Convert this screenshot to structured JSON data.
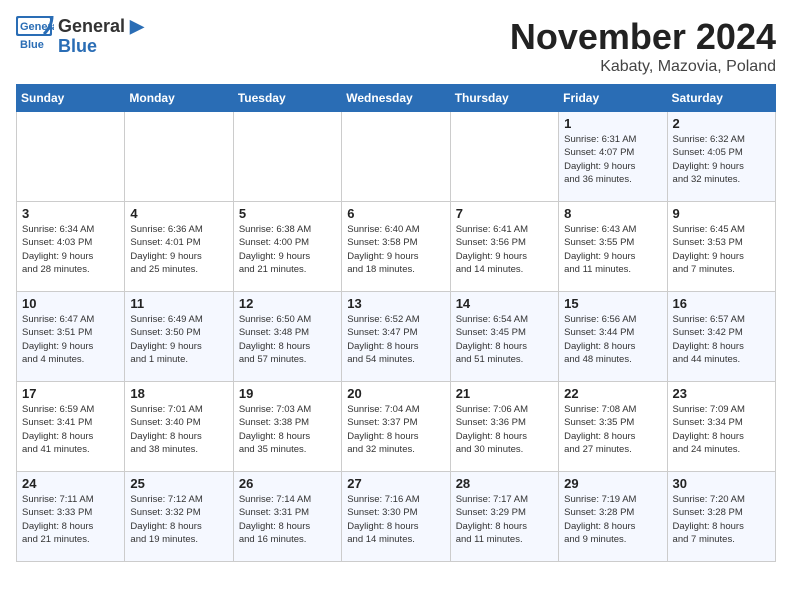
{
  "header": {
    "logo": {
      "line1": "General",
      "line2": "Blue"
    },
    "title": "November 2024",
    "location": "Kabaty, Mazovia, Poland"
  },
  "days_of_week": [
    "Sunday",
    "Monday",
    "Tuesday",
    "Wednesday",
    "Thursday",
    "Friday",
    "Saturday"
  ],
  "weeks": [
    [
      {
        "day": "",
        "info": ""
      },
      {
        "day": "",
        "info": ""
      },
      {
        "day": "",
        "info": ""
      },
      {
        "day": "",
        "info": ""
      },
      {
        "day": "",
        "info": ""
      },
      {
        "day": "1",
        "info": "Sunrise: 6:31 AM\nSunset: 4:07 PM\nDaylight: 9 hours\nand 36 minutes."
      },
      {
        "day": "2",
        "info": "Sunrise: 6:32 AM\nSunset: 4:05 PM\nDaylight: 9 hours\nand 32 minutes."
      }
    ],
    [
      {
        "day": "3",
        "info": "Sunrise: 6:34 AM\nSunset: 4:03 PM\nDaylight: 9 hours\nand 28 minutes."
      },
      {
        "day": "4",
        "info": "Sunrise: 6:36 AM\nSunset: 4:01 PM\nDaylight: 9 hours\nand 25 minutes."
      },
      {
        "day": "5",
        "info": "Sunrise: 6:38 AM\nSunset: 4:00 PM\nDaylight: 9 hours\nand 21 minutes."
      },
      {
        "day": "6",
        "info": "Sunrise: 6:40 AM\nSunset: 3:58 PM\nDaylight: 9 hours\nand 18 minutes."
      },
      {
        "day": "7",
        "info": "Sunrise: 6:41 AM\nSunset: 3:56 PM\nDaylight: 9 hours\nand 14 minutes."
      },
      {
        "day": "8",
        "info": "Sunrise: 6:43 AM\nSunset: 3:55 PM\nDaylight: 9 hours\nand 11 minutes."
      },
      {
        "day": "9",
        "info": "Sunrise: 6:45 AM\nSunset: 3:53 PM\nDaylight: 9 hours\nand 7 minutes."
      }
    ],
    [
      {
        "day": "10",
        "info": "Sunrise: 6:47 AM\nSunset: 3:51 PM\nDaylight: 9 hours\nand 4 minutes."
      },
      {
        "day": "11",
        "info": "Sunrise: 6:49 AM\nSunset: 3:50 PM\nDaylight: 9 hours\nand 1 minute."
      },
      {
        "day": "12",
        "info": "Sunrise: 6:50 AM\nSunset: 3:48 PM\nDaylight: 8 hours\nand 57 minutes."
      },
      {
        "day": "13",
        "info": "Sunrise: 6:52 AM\nSunset: 3:47 PM\nDaylight: 8 hours\nand 54 minutes."
      },
      {
        "day": "14",
        "info": "Sunrise: 6:54 AM\nSunset: 3:45 PM\nDaylight: 8 hours\nand 51 minutes."
      },
      {
        "day": "15",
        "info": "Sunrise: 6:56 AM\nSunset: 3:44 PM\nDaylight: 8 hours\nand 48 minutes."
      },
      {
        "day": "16",
        "info": "Sunrise: 6:57 AM\nSunset: 3:42 PM\nDaylight: 8 hours\nand 44 minutes."
      }
    ],
    [
      {
        "day": "17",
        "info": "Sunrise: 6:59 AM\nSunset: 3:41 PM\nDaylight: 8 hours\nand 41 minutes."
      },
      {
        "day": "18",
        "info": "Sunrise: 7:01 AM\nSunset: 3:40 PM\nDaylight: 8 hours\nand 38 minutes."
      },
      {
        "day": "19",
        "info": "Sunrise: 7:03 AM\nSunset: 3:38 PM\nDaylight: 8 hours\nand 35 minutes."
      },
      {
        "day": "20",
        "info": "Sunrise: 7:04 AM\nSunset: 3:37 PM\nDaylight: 8 hours\nand 32 minutes."
      },
      {
        "day": "21",
        "info": "Sunrise: 7:06 AM\nSunset: 3:36 PM\nDaylight: 8 hours\nand 30 minutes."
      },
      {
        "day": "22",
        "info": "Sunrise: 7:08 AM\nSunset: 3:35 PM\nDaylight: 8 hours\nand 27 minutes."
      },
      {
        "day": "23",
        "info": "Sunrise: 7:09 AM\nSunset: 3:34 PM\nDaylight: 8 hours\nand 24 minutes."
      }
    ],
    [
      {
        "day": "24",
        "info": "Sunrise: 7:11 AM\nSunset: 3:33 PM\nDaylight: 8 hours\nand 21 minutes."
      },
      {
        "day": "25",
        "info": "Sunrise: 7:12 AM\nSunset: 3:32 PM\nDaylight: 8 hours\nand 19 minutes."
      },
      {
        "day": "26",
        "info": "Sunrise: 7:14 AM\nSunset: 3:31 PM\nDaylight: 8 hours\nand 16 minutes."
      },
      {
        "day": "27",
        "info": "Sunrise: 7:16 AM\nSunset: 3:30 PM\nDaylight: 8 hours\nand 14 minutes."
      },
      {
        "day": "28",
        "info": "Sunrise: 7:17 AM\nSunset: 3:29 PM\nDaylight: 8 hours\nand 11 minutes."
      },
      {
        "day": "29",
        "info": "Sunrise: 7:19 AM\nSunset: 3:28 PM\nDaylight: 8 hours\nand 9 minutes."
      },
      {
        "day": "30",
        "info": "Sunrise: 7:20 AM\nSunset: 3:28 PM\nDaylight: 8 hours\nand 7 minutes."
      }
    ]
  ]
}
